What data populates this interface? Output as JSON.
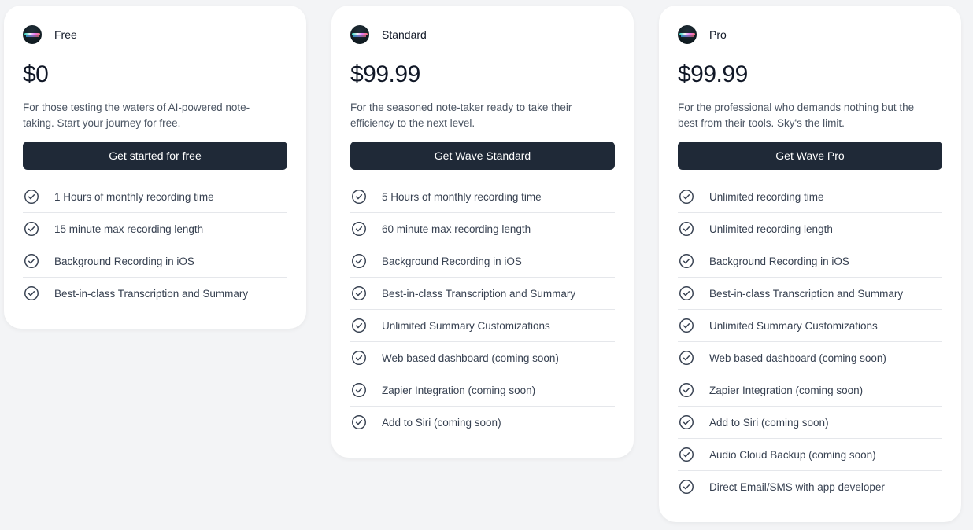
{
  "colors": {
    "background": "#f3f4f6",
    "card": "#ffffff",
    "button": "#1f2937",
    "button_text": "#ffffff",
    "text": "#111827",
    "muted_text": "#4b5563"
  },
  "plans": [
    {
      "name": "Free",
      "price": "$0",
      "description": "For those testing the waters of AI-powered note-taking. Start your journey for free.",
      "cta_label": "Get started for free",
      "features": [
        "1 Hours of monthly recording time",
        "15 minute max recording length",
        "Background Recording in iOS",
        "Best-in-class Transcription and Summary"
      ]
    },
    {
      "name": "Standard",
      "price": "$99.99",
      "description": "For the seasoned note-taker ready to take their efficiency to the next level.",
      "cta_label": "Get Wave Standard",
      "features": [
        "5 Hours of monthly recording time",
        "60 minute max recording length",
        "Background Recording in iOS",
        "Best-in-class Transcription and Summary",
        "Unlimited Summary Customizations",
        "Web based dashboard (coming soon)",
        "Zapier Integration (coming soon)",
        "Add to Siri (coming soon)"
      ]
    },
    {
      "name": "Pro",
      "price": "$99.99",
      "description": "For the professional who demands nothing but the best from their tools. Sky's the limit.",
      "cta_label": "Get Wave Pro",
      "features": [
        "Unlimited recording time",
        "Unlimited recording length",
        "Background Recording in iOS",
        "Best-in-class Transcription and Summary",
        "Unlimited Summary Customizations",
        "Web based dashboard (coming soon)",
        "Zapier Integration (coming soon)",
        "Add to Siri (coming soon)",
        "Audio Cloud Backup (coming soon)",
        "Direct Email/SMS with app developer"
      ]
    }
  ],
  "icons": {
    "plan_logo": "wave-logo-icon",
    "feature_bullet": "check-circle-icon"
  }
}
